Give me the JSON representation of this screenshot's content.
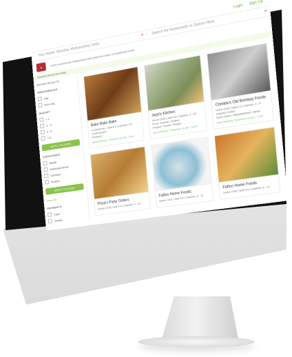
{
  "topbar": {
    "links": [
      "Login",
      "Sign Up"
    ]
  },
  "search": {
    "left_placeholder": "Your Name: Mumbai, Maharashtra, India",
    "right_placeholder": "Search for Homechefs or Dishes Here"
  },
  "top_notice": "100% Homemade restaurants with authentic taste of traditional home",
  "alert_text": "Delivery timing for today",
  "sidebar": {
    "refine_title": "REFINE RESULTS",
    "preferences_title": "PREFERENCES",
    "preferences": [
      "Veg",
      "Non-veg"
    ],
    "budget_title": "BUDGET",
    "budget_items": [
      "< 1",
      "1 - 3",
      "3 - 5",
      "> 5"
    ],
    "apply_label": "APPLY FILTERS",
    "categories_title": "CATEGORIES",
    "categories": [
      "Meals",
      "Individual Items",
      "Combos",
      "Snacks"
    ],
    "apply_label_2": "APPLY FILTERS",
    "clear_label": "Clear All",
    "payments_title": "PAYMENTS",
    "payments": [
      "Cash",
      "Online"
    ]
  },
  "cards": [
    {
      "title": "Bake Bake Bake",
      "meta": [
        "Confectioner | Vadi 4.0 | Calories: 4.5",
        "Confectioners",
        "Desserts"
      ],
      "tag": "Next Delivery: Tomorrow 11 am - 5 pm"
    },
    {
      "title": "Jaya's Kitchen",
      "meta": [
        "Home Chef | Vadi 4.5 | Calories: 4 - 50",
        "Pune: Gujarati / Konkan",
        "Punjabi / Sindhi / Punjabi"
      ],
      "tag": "Next Delivery: Tomorrow 11 am - 5 pm"
    },
    {
      "title": "Chedda's Old Bombay Foods",
      "meta": [
        "Home Chef | Vadi 4.0 | Calories: 4 - 8",
        "Gujarati | Indian",
        "North Indian / Maharashtrian / Street"
      ],
      "tag": "Next Delivery: Tomorrow 10 am - 2 pm"
    },
    {
      "title": "Priya's Party Orders",
      "meta": [
        "Home Chef | Vadi 4.0 | Calories: 4 - 10"
      ],
      "tag": ""
    },
    {
      "title": "Fafino Home Foods",
      "meta": [
        "Home Chef | Vadi 4.5 | Calories: 4 - 12"
      ],
      "tag": ""
    },
    {
      "title": "Fafino Home Foods",
      "meta": [
        "Home Chef | Vadi 4.5 | Calories: 4 - 12"
      ],
      "tag": ""
    }
  ]
}
